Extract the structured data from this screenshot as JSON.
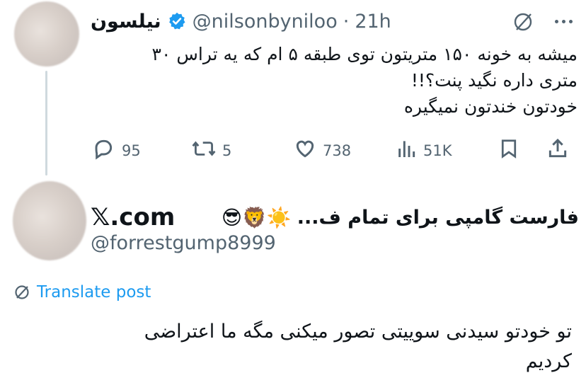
{
  "tweet": {
    "display_name": "نیلسون",
    "handle": "@nilsonbyniloo",
    "separator": "·",
    "time": "21h",
    "text_lines": [
      "میشه به خونه ۱۵۰ متریتون توی طبقه ۵ ام که یه تراس ۳۰",
      "متری داره نگید پنت؟!!",
      "خودتون خندتون نمیگیره"
    ],
    "actions": {
      "replies": "95",
      "reposts": "5",
      "likes": "738",
      "views": "51K"
    }
  },
  "reply": {
    "display_name": "فارست گامپی برای تمام ف...",
    "emojis": "😎🦁☀️",
    "handle": "@forrestgump8999",
    "translate_label": "Translate post",
    "text_lines": [
      "تو خودتو سیدنی سوییتی تصور میکنی مگه ما اعتراضی",
      "کردیم"
    ]
  },
  "watermark": {
    "brand": "𝕏.com"
  },
  "colors": {
    "accent": "#1d9bf0",
    "secondary_text": "#536471",
    "verified_badge": "#1d9bf0"
  }
}
